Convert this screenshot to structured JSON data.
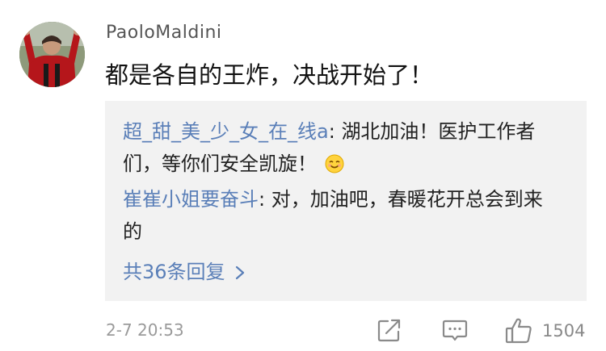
{
  "comment": {
    "username": "PaoloMaldini",
    "text": "都是各自的王炸，决战开始了！",
    "timestamp": "2-7 20:53",
    "like_count": "1504"
  },
  "replies": [
    {
      "user": "超_甜_美_少_女_在_线a",
      "separator": ": ",
      "text": "湖北加油！医护工作者们，等你们安全凯旋！",
      "emoji": "smile-emoji"
    },
    {
      "user": "崔崔小姐要奋斗",
      "separator": ": ",
      "text": "对，加油吧，春暖花开总会到来的"
    }
  ],
  "more_replies_label": "共36条回复",
  "icons": [
    "share-icon",
    "comment-icon",
    "thumbs-up-icon",
    "chevron-right-icon"
  ],
  "colors": {
    "link": "#5a7fb8",
    "reply_bg": "#f2f2f2",
    "meta": "#9a9a9a"
  }
}
